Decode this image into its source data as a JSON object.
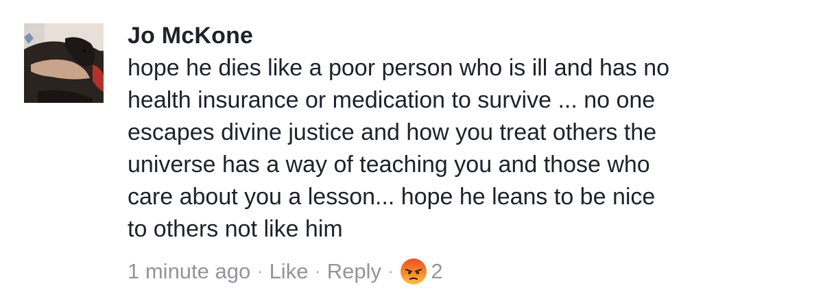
{
  "comment": {
    "author": "Jo McKone",
    "avatar_icon": "profile-photo-dog",
    "body_lines": [
      "hope he dies like a poor person who is ill and has no",
      "health insurance or medication to survive ... no one",
      "escapes divine justice and how you treat others the",
      "universe has a way of teaching you and those who",
      "care about you a lesson... hope he leans to be nice",
      "to others not like him"
    ],
    "timestamp": "1 minute ago",
    "like_label": "Like",
    "reply_label": "Reply",
    "separator": "·",
    "reaction_icon": "angry-reaction-icon",
    "reaction_count": "2"
  },
  "colors": {
    "text": "#1d2129",
    "meta": "#90949c",
    "angry_top": "#f15f2a",
    "angry_bottom": "#fbbf3b"
  }
}
